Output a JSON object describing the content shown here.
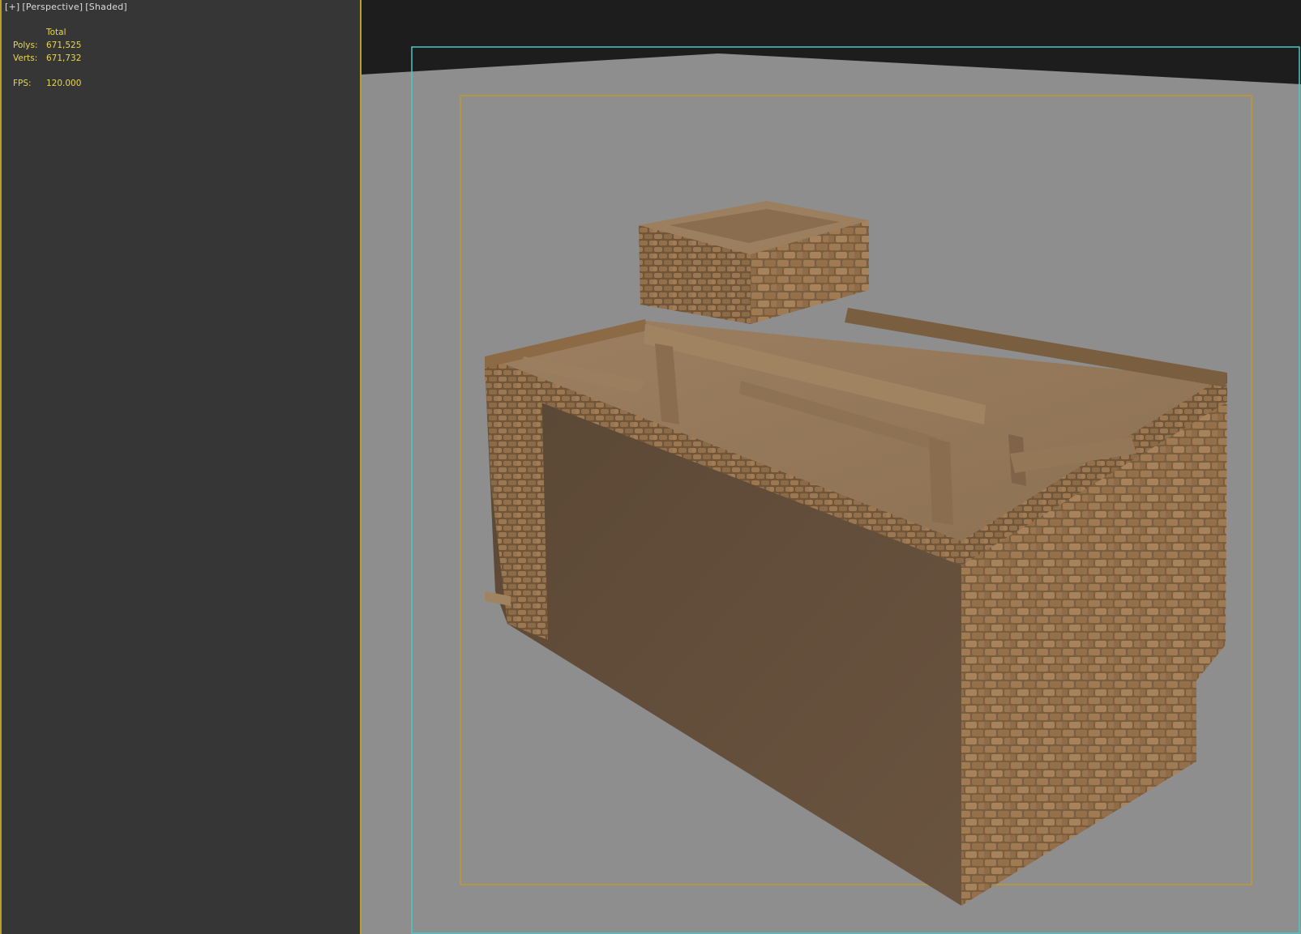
{
  "viewport": {
    "label_plus": "[+]",
    "label_view": "[Perspective]",
    "label_shading": "[Shaded]"
  },
  "stats": {
    "header": "Total",
    "polys_label": "Polys:",
    "polys_value": "671,525",
    "verts_label": "Verts:",
    "verts_value": "671,732",
    "fps_label": "FPS:",
    "fps_value": "120.000"
  },
  "colors": {
    "panel_bg": "#363636",
    "panel_border": "#b8a02a",
    "stats_text": "#e8d84a",
    "label_text": "#dcdcdc",
    "ground": "#8e8e8e",
    "sky": "#1d1d1d",
    "safe_frame_outer": "#4fc6c8",
    "safe_frame_inner": "#c09a2c",
    "stone_light": "#a07a52",
    "stone_dark": "#5e4a35"
  },
  "scene": {
    "object": "stone-building-with-wooden-roof-structure"
  }
}
